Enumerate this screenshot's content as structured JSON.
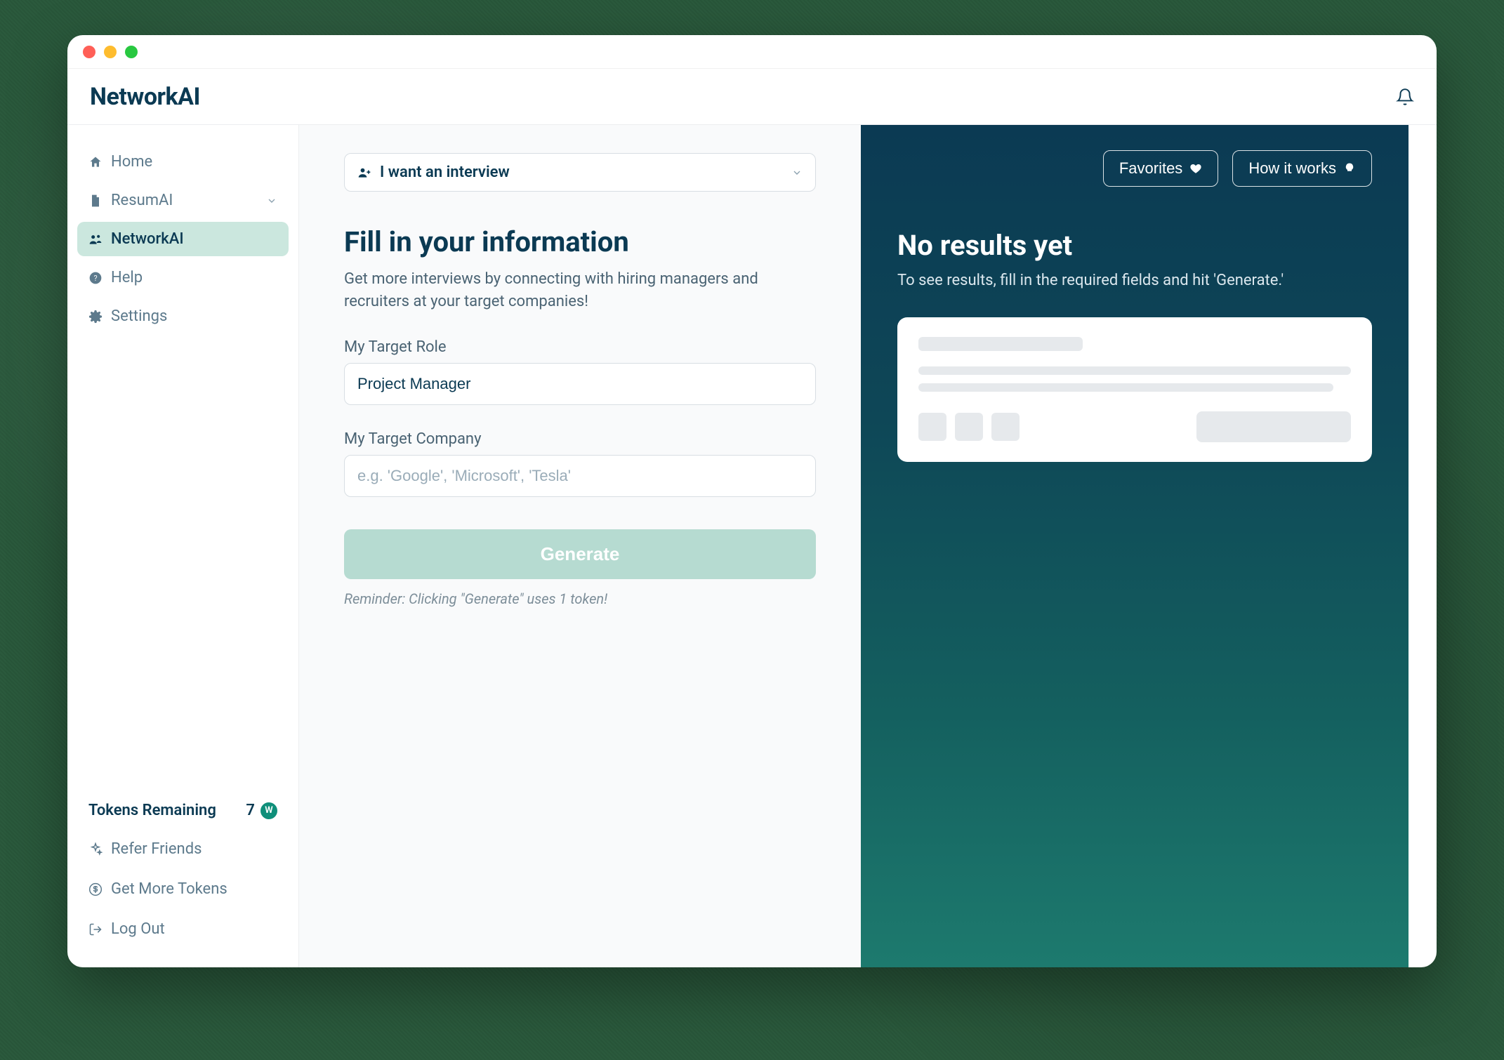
{
  "brand": "NetworkAI",
  "sidebar": {
    "items": [
      {
        "label": "Home"
      },
      {
        "label": "ResumAI"
      },
      {
        "label": "NetworkAI"
      },
      {
        "label": "Help"
      },
      {
        "label": "Settings"
      }
    ],
    "tokens_label": "Tokens Remaining",
    "tokens_value": "7",
    "footer": [
      {
        "label": "Refer Friends"
      },
      {
        "label": "Get More Tokens"
      },
      {
        "label": "Log Out"
      }
    ]
  },
  "form": {
    "goal_label": "I want an interview",
    "title": "Fill in your information",
    "subtitle": "Get more interviews by connecting with hiring managers and recruiters at your target companies!",
    "role_label": "My Target Role",
    "role_value": "Project Manager",
    "company_label": "My Target Company",
    "company_placeholder": "e.g. 'Google', 'Microsoft', 'Tesla'",
    "generate_label": "Generate",
    "reminder": "Reminder: Clicking \"Generate\" uses 1 token!"
  },
  "results": {
    "favorites_label": "Favorites",
    "howitworks_label": "How it works",
    "title": "No results yet",
    "subtitle": "To see results, fill in the required fields and hit 'Generate.'"
  }
}
